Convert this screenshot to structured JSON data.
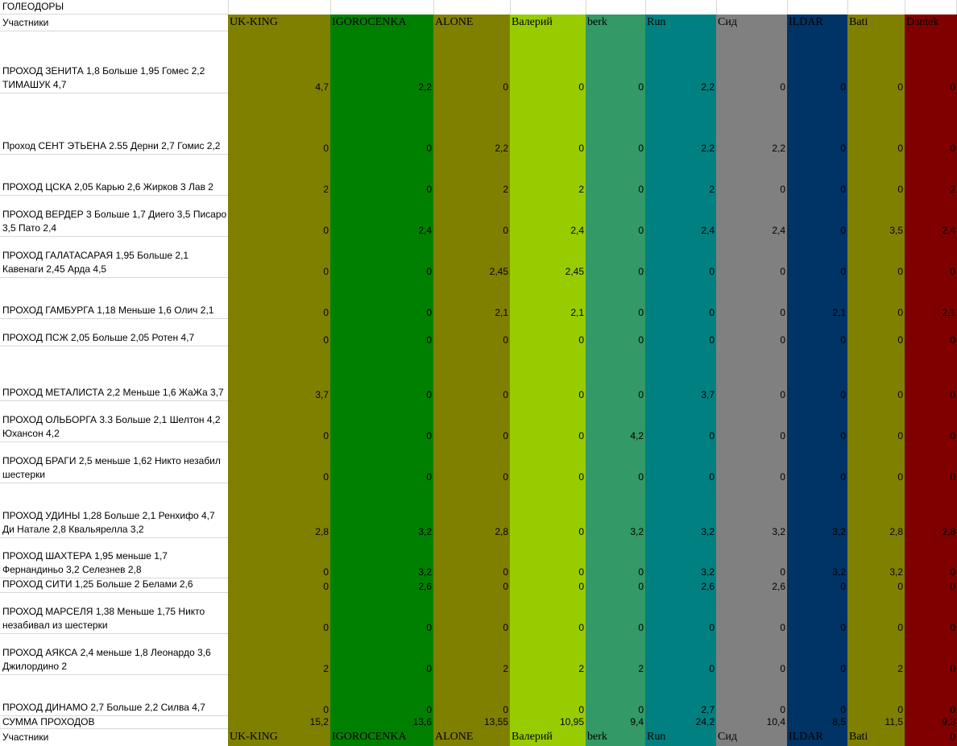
{
  "sheet_title": "ГОЛЕОДОРЫ",
  "participants_label": "Участники",
  "sum_label": "СУММА ПРОХОДОВ",
  "participants": [
    {
      "name": "UK-KING",
      "color": "#808000",
      "text_color": "#000000"
    },
    {
      "name": "IGOROCENKA",
      "color": "#008000",
      "text_color": "#000000"
    },
    {
      "name": "ALONE",
      "color": "#808000",
      "text_color": "#000000"
    },
    {
      "name": "Валерий",
      "color": "#99cc00",
      "text_color": "#000000"
    },
    {
      "name": "berk",
      "color": "#339966",
      "text_color": "#000000"
    },
    {
      "name": "Run",
      "color": "#008080",
      "text_color": "#000000"
    },
    {
      "name": "Сид",
      "color": "#808080",
      "text_color": "#000000"
    },
    {
      "name": "ILDAR",
      "color": "#003366",
      "text_color": "#000000"
    },
    {
      "name": "Bati",
      "color": "#808000",
      "text_color": "#000000"
    },
    {
      "name": "Dantek",
      "color": "#800000",
      "text_color": "#000000"
    }
  ],
  "rows": [
    {
      "label": "ПРОХОД ЗЕНИТА 1,8 Больше 1,95    Гомес 2,2 ТИМАШУК 4,7",
      "values": [
        "4,7",
        "2,2",
        "0",
        "0",
        "0",
        "2,2",
        "0",
        "0",
        "0",
        "0"
      ]
    },
    {
      "label": "Проход СЕНТ ЭТЬЕНА  2.55 Дерни 2,7 Гомис 2,2",
      "values": [
        "0",
        "0",
        "2,2",
        "0",
        "0",
        "2,2",
        "2,2",
        "0",
        "0",
        "0"
      ]
    },
    {
      "label": "ПРОХОД ЦСКА 2,05 Карью 2,6 Жирков 3 Лав 2",
      "values": [
        "2",
        "0",
        "2",
        "2",
        "0",
        "2",
        "0",
        "0",
        "0",
        "2"
      ]
    },
    {
      "label": "ПРОХОД ВЕРДЕР 3 Больше 1,7 Диего 3,5 Писаро 3,5 Пато 2,4",
      "values": [
        "0",
        "2,4",
        "0",
        "2,4",
        "0",
        "2,4",
        "2,4",
        "0",
        "3,5",
        "2,4"
      ]
    },
    {
      "label": "ПРОХОД ГАЛАТАСАРАЯ 1,95  Больше 2,1 Кавенаги 2,45 Арда  4,5",
      "values": [
        "0",
        "0",
        "2,45",
        "2,45",
        "0",
        "0",
        "0",
        "0",
        "0",
        "0"
      ]
    },
    {
      "label": "ПРОХОД ГАМБУРГА  1,18 Меньше 1,6 Олич 2,1",
      "values": [
        "0",
        "0",
        "2,1",
        "2,1",
        "0",
        "0",
        "0",
        "2,1",
        "0",
        "2,1"
      ]
    },
    {
      "label": "ПРОХОД ПСЖ 2,05 Больше 2,05 Ротен 4,7",
      "values": [
        "0",
        "0",
        "0",
        "0",
        "0",
        "0",
        "0",
        "0",
        "0",
        "0"
      ]
    },
    {
      "label": "ПРОХОД МЕТАЛИСТА 2,2  Меньше 1,6 ЖаЖа 3,7",
      "values": [
        "3,7",
        "0",
        "0",
        "0",
        "0",
        "3,7",
        "0",
        "0",
        "0",
        "0"
      ]
    },
    {
      "label": "ПРОХОД ОЛЬБОРГА 3.3  Больше 2,1 Шелтон 4,2 Юхансон 4,2",
      "values": [
        "0",
        "0",
        "0",
        "0",
        "4,2",
        "0",
        "0",
        "0",
        "0",
        "0"
      ]
    },
    {
      "label": "ПРОХОД БРАГИ  2,5 меньше 1,62  Никто незабил шестерки",
      "values": [
        "0",
        "0",
        "0",
        "0",
        "0",
        "0",
        "0",
        "0",
        "0",
        "0"
      ]
    },
    {
      "label": "ПРОХОД УДИНЫ 1,28   Больше 2,1 Ренхифо 4,7  Ди Натале 2,8 Квальярелла 3,2",
      "values": [
        "2,8",
        "3,2",
        "2,8",
        "0",
        "3,2",
        "3,2",
        "3,2",
        "3,2",
        "2,8",
        "2,8"
      ]
    },
    {
      "label": "ПРОХОД ШАХТЕРА 1,95  меньше 1,7 Фернандиньо 3,2 Селезнев 2,8",
      "values": [
        "0",
        "3,2",
        "0",
        "0",
        "0",
        "3,2",
        "0",
        "3,2",
        "3,2",
        "0"
      ]
    },
    {
      "label": "ПРОХОД СИТИ 1,25  Больше 2 Белами 2,6",
      "values": [
        "0",
        "2,6",
        "0",
        "0",
        "0",
        "2,6",
        "2,6",
        "0",
        "0",
        "0"
      ]
    },
    {
      "label": "ПРОХОД МАРСЕЛЯ  1,38  Меньше 1,75 Никто незабивал из шестерки",
      "values": [
        "0",
        "0",
        "0",
        "0",
        "0",
        "0",
        "0",
        "0",
        "0",
        "0"
      ]
    },
    {
      "label": "ПРОХОД АЯКСА  2,4 меньше 1,8 Леонардо 3,6 Джилордино 2",
      "values": [
        "2",
        "0",
        "2",
        "2",
        "2",
        "0",
        "0",
        "0",
        "2",
        "0"
      ]
    },
    {
      "label": "ПРОХОД ДИНАМО 2,7 Больше 2,2 Силва 4,7",
      "values": [
        "0",
        "0",
        "0",
        "0",
        "0",
        "2,7",
        "0",
        "0",
        "0",
        "0"
      ]
    }
  ],
  "sums": [
    "15,2",
    "13,6",
    "13,55",
    "10,95",
    "9,4",
    "24,2",
    "10,4",
    "8,5",
    "11,5",
    "9,3"
  ],
  "footer_extra_values": [
    "0"
  ]
}
